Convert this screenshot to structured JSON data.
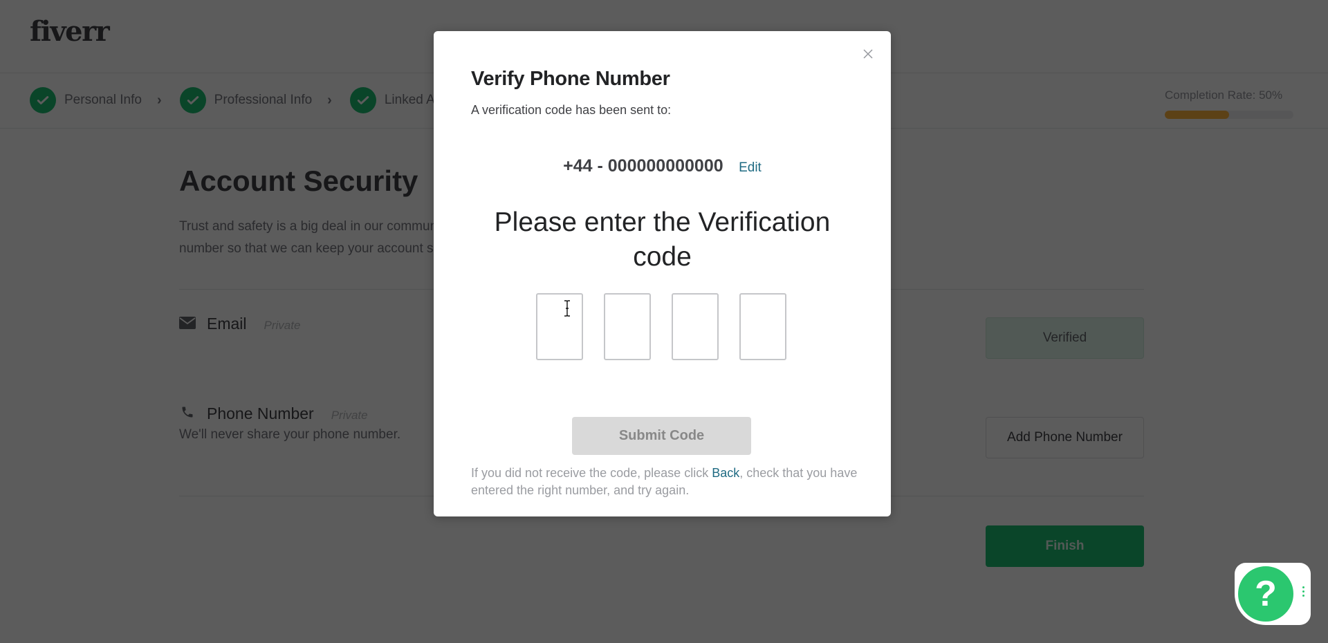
{
  "brand": {
    "logo_text": "fiverr"
  },
  "steps": [
    {
      "label": "Personal Info",
      "done": true
    },
    {
      "label": "Professional Info",
      "done": true
    },
    {
      "label": "Linked Accounts",
      "done": true
    }
  ],
  "completion": {
    "label": "Completion Rate: 50%",
    "percent": 50
  },
  "section": {
    "title": "Account Security",
    "description": "Trust and safety is a big deal in our community. Please verify your email and phone number so that we can keep your account secured.",
    "rows": [
      {
        "icon": "envelope-icon",
        "title": "Email",
        "privacy": "Private",
        "subtitle": "",
        "button": "Verified"
      },
      {
        "icon": "phone-icon",
        "title": "Phone Number",
        "privacy": "Private",
        "subtitle": "We'll never share your phone number.",
        "button": "Add Phone Number"
      }
    ],
    "finish_label": "Finish"
  },
  "modal": {
    "title": "Verify Phone Number",
    "subtitle": "A verification code has been sent to:",
    "phone_number": "+44 - 000000000000",
    "edit_label": "Edit",
    "prompt": "Please enter the Verification code",
    "code_digits": [
      "",
      "",
      "",
      ""
    ],
    "submit_label": "Submit Code",
    "footer_prefix": "If you did not receive the code, please click ",
    "footer_link": "Back",
    "footer_suffix": ", check that you have entered the right number, and try again.",
    "close_icon": "close-icon"
  },
  "help": {
    "label": "?"
  },
  "colors": {
    "brand_green": "#1dbf73",
    "link_teal": "#1e6a82",
    "progress_orange": "#ffb33e",
    "help_green": "#2bc76f"
  }
}
